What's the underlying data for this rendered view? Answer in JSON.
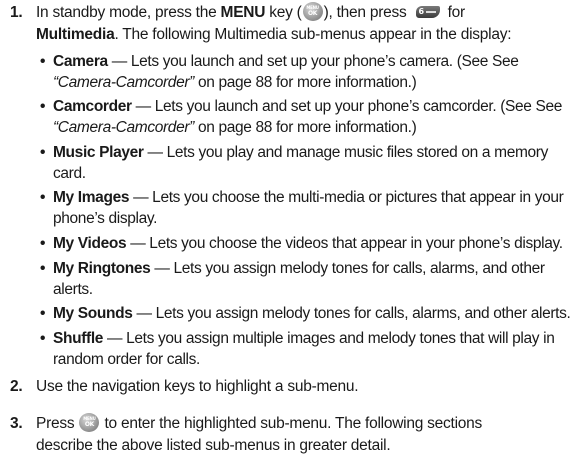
{
  "steps": [
    {
      "number": "1.",
      "line1_pre": "In standby mode, press the ",
      "menu_key": "MENU",
      "line1_mid": " key (",
      "line1_mid2": "), then press ",
      "line1_post": " for",
      "line2_bold": "Multimedia",
      "line2_rest": ". The following Multimedia sub-menus appear in the display:"
    },
    {
      "number": "2.",
      "text": "Use the navigation keys to highlight a sub-menu."
    },
    {
      "number": "3.",
      "line1_pre": "Press ",
      "line1_post": " to enter the highlighted sub-menu. The following sections",
      "line2": "describe the above listed sub-menus in greater detail."
    }
  ],
  "submenus": [
    {
      "name": "Camera",
      "desc1": " — Lets you launch and set up your phone’s camera. (See See",
      "ref": "“Camera-Camcorder”",
      "desc2": " on page 88 for more information.)"
    },
    {
      "name": "Camcorder",
      "desc1": " — Lets you launch and set up your phone’s camcorder. (See See",
      "ref": "“Camera-Camcorder”",
      "desc2": " on page 88 for more information.)"
    },
    {
      "name": "Music Player",
      "desc1": " — Lets you play and manage music files stored on a memory",
      "desc2": "card."
    },
    {
      "name": "My Images",
      "desc1": " — Lets you choose the multi-media or pictures that appear in your",
      "desc2": "phone’s display."
    },
    {
      "name": "My Videos",
      "desc1": " — Lets you choose the videos that appear in your phone’s display."
    },
    {
      "name": "My Ringtones",
      "desc1": " — Lets you assign melody tones for calls, alarms, and other",
      "desc2": "alerts."
    },
    {
      "name": "My Sounds",
      "desc1": " — Lets you assign melody tones for calls, alarms, and other alerts."
    },
    {
      "name": "Shuffle",
      "desc1": " — Lets you assign multiple images and melody tones that will play in",
      "desc2": "random order for calls."
    }
  ],
  "bullet_char": "•",
  "icons": {
    "menu_ok_key": "menu-ok-key-icon",
    "multimedia_key": "multimedia-6-key-icon"
  }
}
